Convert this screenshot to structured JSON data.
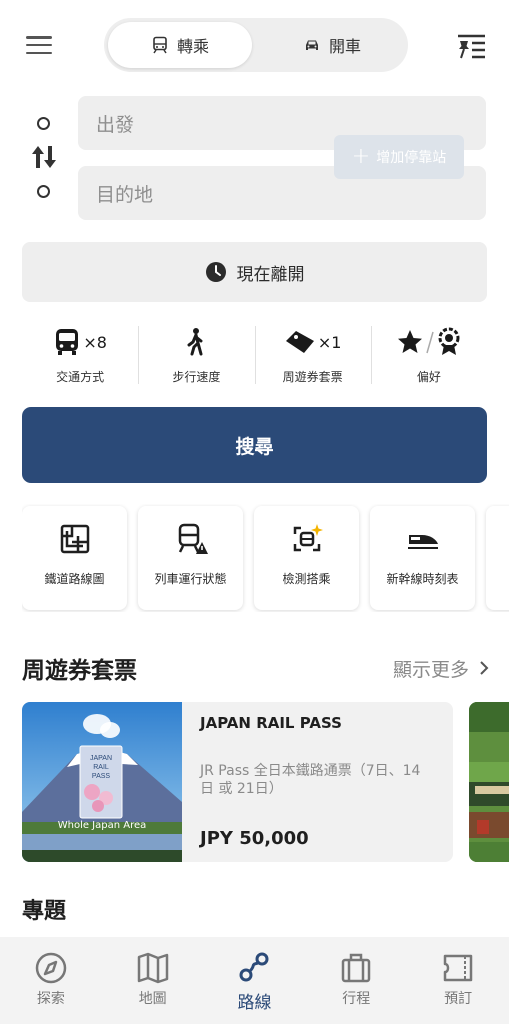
{
  "header": {
    "modes": {
      "transit_label": "轉乘",
      "drive_label": "開車",
      "selected": "轉乘"
    }
  },
  "route_form": {
    "origin_placeholder": "出發",
    "destination_placeholder": "目的地",
    "add_stop_label": "增加停靠站"
  },
  "time": {
    "label": "現在離開"
  },
  "options": [
    {
      "label": "交通方式",
      "count": "×8"
    },
    {
      "label": "步行速度",
      "count": ""
    },
    {
      "label": "周遊券套票",
      "count": "×1"
    },
    {
      "label": "偏好",
      "count": ""
    }
  ],
  "search": {
    "label": "搜尋"
  },
  "tools": [
    {
      "label": "鐵道路線圖",
      "icon": "rail-map-icon"
    },
    {
      "label": "列車運行狀態",
      "icon": "train-status-icon"
    },
    {
      "label": "檢測搭乘",
      "icon": "ride-detect-icon"
    },
    {
      "label": "新幹線時刻表",
      "icon": "shinkansen-icon"
    }
  ],
  "passes_section": {
    "title": "周遊券套票",
    "more_label": "顯示更多"
  },
  "pass_card": {
    "title": "JAPAN RAIL PASS",
    "description": "JR Pass 全日本鐵路通票（7日、14日 或 21日）",
    "price": "JPY 50,000",
    "image_caption": "Whole Japan Area",
    "ticket_text": "JAPAN RAIL PASS"
  },
  "topics": {
    "title": "專題"
  },
  "bottom_nav": [
    {
      "label": "探索",
      "icon": "compass-icon",
      "active": false
    },
    {
      "label": "地圖",
      "icon": "map-icon",
      "active": false
    },
    {
      "label": "路線",
      "icon": "route-icon",
      "active": true
    },
    {
      "label": "行程",
      "icon": "suitcase-icon",
      "active": false
    },
    {
      "label": "預訂",
      "icon": "ticket-icon",
      "active": false
    }
  ],
  "colors": {
    "primary": "#2b4a78",
    "field_bg": "#eeeeee",
    "muted_text": "#8f8f8f",
    "nav_bg": "#f3f3f3"
  }
}
